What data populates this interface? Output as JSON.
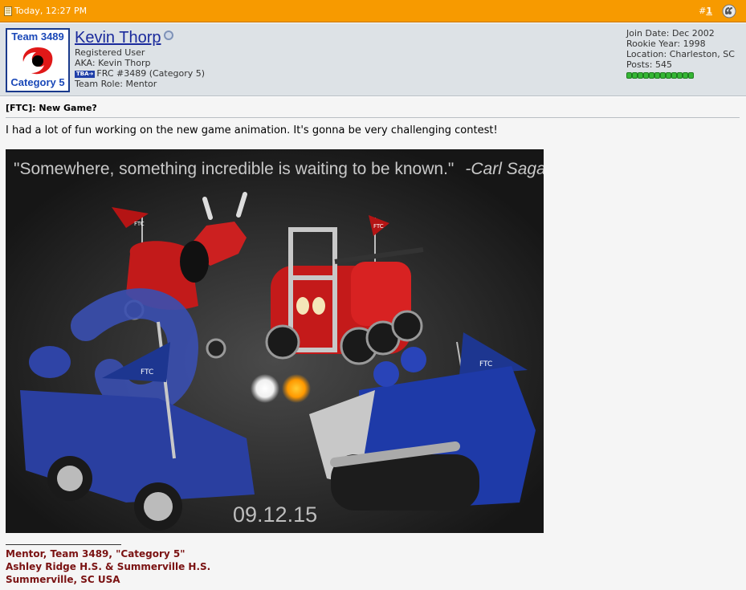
{
  "post_header": {
    "date": "Today, 12:27 PM",
    "post_hash": "#",
    "post_number": "1",
    "icons": {
      "doc": "document-icon",
      "multi": "multi-quote-icon"
    }
  },
  "user": {
    "avatar": {
      "line1": "Team 3489",
      "line2": "Category 5",
      "icon": "hurricane-icon"
    },
    "name": "Kevin Thorp",
    "status_icon": "online-status-icon",
    "title": "Registered User",
    "aka": "AKA: Kevin Thorp",
    "tba_badge": "TBA➔",
    "frc": "FRC #3489 (Category 5)",
    "role": "Team Role: Mentor"
  },
  "stats": {
    "join_date": "Join Date: Dec 2002",
    "rookie_year": "Rookie Year: 1998",
    "location": "Location: Charleston, SC",
    "posts": "Posts: 545",
    "reputation_pips": 12
  },
  "post": {
    "title": "[FTC]: New Game?",
    "text": "I had a lot of fun working on the new game animation. It's gonna be very challenging contest!",
    "image": {
      "quote": "\"Somewhere, something incredible is waiting to be known.\"",
      "quote_author": "-Carl Sagan",
      "date_text": "09.12.15",
      "flag_text": "FTC"
    }
  },
  "signature": {
    "line1": "Mentor, Team 3489, \"Category 5\"",
    "line2": "Ashley Ridge H.S. & Summerville H.S.",
    "line3": "Summerville, SC USA"
  },
  "colors": {
    "header_orange": "#f79a00",
    "userbar_gray": "#dde2e6",
    "signature_red": "#7a1212",
    "link_blue": "#1a2a9c"
  }
}
